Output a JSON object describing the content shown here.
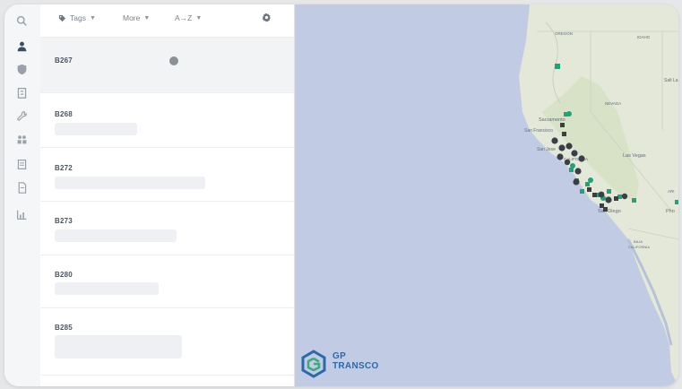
{
  "toolbar": {
    "tags_label": "Tags",
    "more_label": "More",
    "sort_label": "A→Z"
  },
  "sidebar_icons": [
    "search-icon",
    "user-icon",
    "shield-icon",
    "building-icon",
    "wrench-icon",
    "people-icon",
    "form-icon",
    "document-icon",
    "chart-icon"
  ],
  "list": {
    "items": [
      {
        "label": "B267"
      },
      {
        "label": "B268"
      },
      {
        "label": "B272"
      },
      {
        "label": "B273"
      },
      {
        "label": "B280"
      },
      {
        "label": "B285"
      }
    ]
  },
  "map": {
    "labels": {
      "oregon": "OREGON",
      "idaho": "IDAHO",
      "nevada": "NEVADA",
      "salt_lake": "Salt La",
      "sacramento": "Sacramento",
      "san_francisco": "San Francisco",
      "san_jose": "San Jose",
      "california": "CALIFORNIA",
      "las_vegas": "Las Vegas",
      "san_diego": "San Diego",
      "phoenix": "Pho",
      "ariz": "ARI",
      "baja": "BAJA",
      "baja2": "CALIFORNIA"
    },
    "marker_colors": {
      "green": "#1fa37a",
      "dark": "#3a3f47"
    }
  },
  "brand": {
    "line1": "GP",
    "line2": "TRANSCO",
    "color": "#2b6aa8"
  }
}
